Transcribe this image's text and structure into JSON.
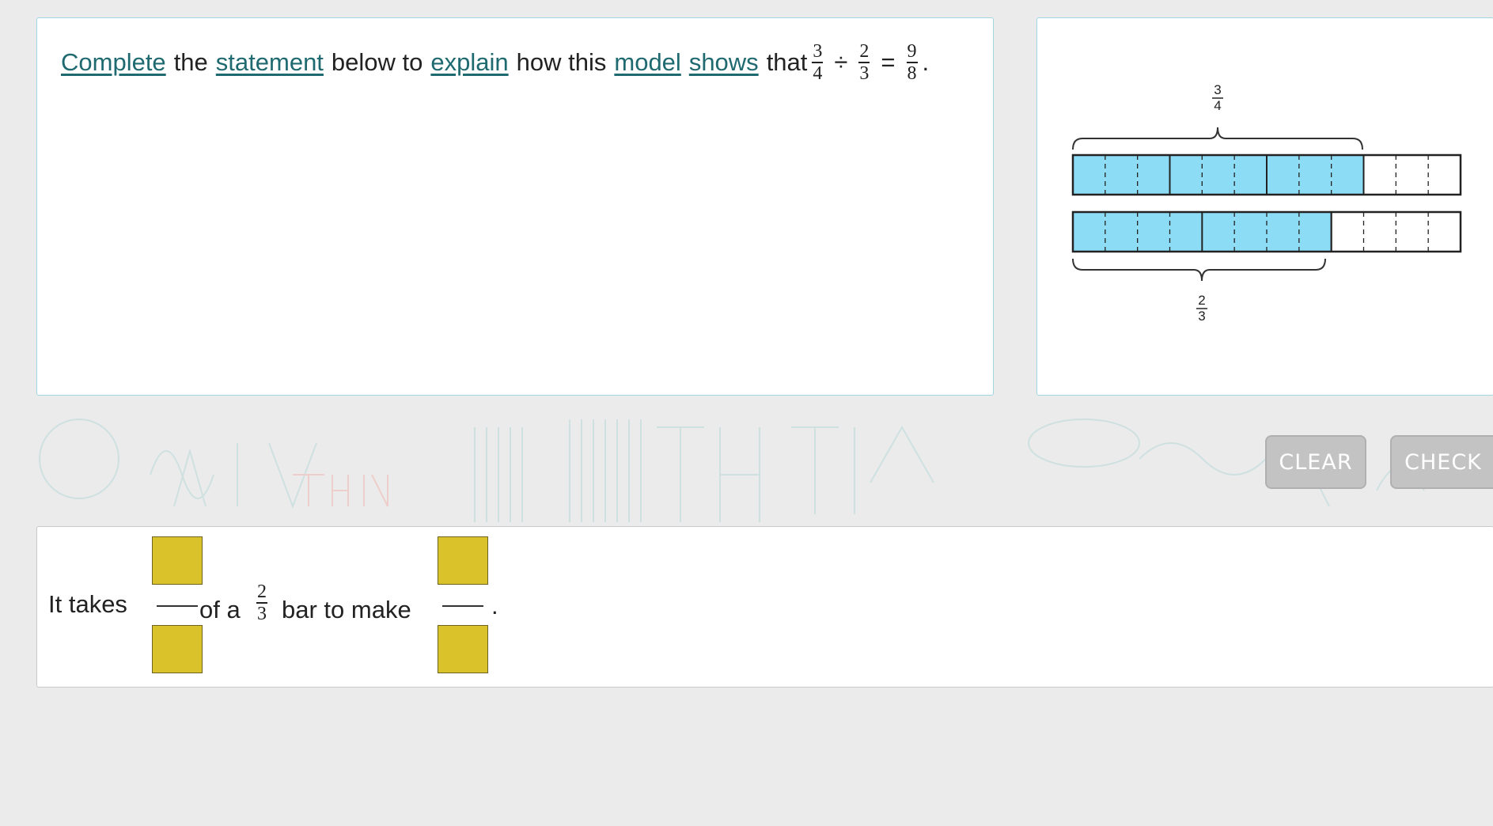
{
  "question": {
    "words": {
      "w1": "Complete",
      "w2": "the",
      "w3": "statement",
      "w4": "below to",
      "w5": "explain",
      "w6": "how this",
      "w7": "model",
      "w8": "shows",
      "w9": "that"
    },
    "expression": {
      "a_num": "3",
      "a_den": "4",
      "op": "÷",
      "b_num": "2",
      "b_den": "3",
      "eq": "=",
      "r_num": "9",
      "r_den": "8",
      "end": "."
    }
  },
  "model": {
    "top_label_num": "3",
    "top_label_den": "4",
    "bottom_label_num": "2",
    "bottom_label_den": "3",
    "top_bar": {
      "total_parts": 12,
      "shaded_parts": 9,
      "group_size": 3
    },
    "bottom_bar": {
      "total_parts": 12,
      "shaded_parts": 8,
      "group_size": 4
    },
    "shade_color": "#8ddcf5"
  },
  "buttons": {
    "clear": "CLEAR",
    "check": "CHECK"
  },
  "answer": {
    "it_takes": "It takes",
    "of_a": "of a",
    "frac_num": "2",
    "frac_den": "3",
    "bar_to_make": "bar to make",
    "period": ".",
    "blank_mark": "____",
    "input_color": "#d9c22a"
  }
}
